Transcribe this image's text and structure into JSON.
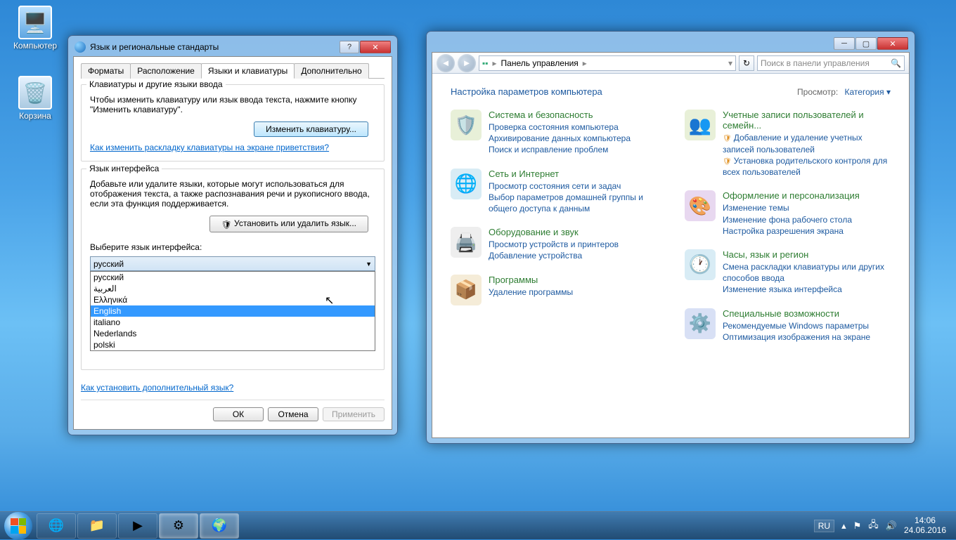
{
  "desktop": {
    "computer": "Компьютер",
    "recycle": "Корзина"
  },
  "regionDialog": {
    "title": "Язык и региональные стандарты",
    "tabs": {
      "formats": "Форматы",
      "location": "Расположение",
      "keyboards": "Языки и клавиатуры",
      "advanced": "Дополнительно"
    },
    "grp1": {
      "legend": "Клавиатуры и другие языки ввода",
      "text": "Чтобы изменить клавиатуру или язык ввода текста, нажмите кнопку \"Изменить клавиатуру\".",
      "btn": "Изменить клавиатуру...",
      "link": "Как изменить раскладку клавиатуры на экране приветствия?"
    },
    "grp2": {
      "legend": "Язык интерфейса",
      "text": "Добавьте или удалите языки, которые могут использоваться для отображения текста, а также распознавания речи и рукописного ввода, если эта функция поддерживается.",
      "btn": "Установить или удалить язык...",
      "chooseLabel": "Выберите язык интерфейса:",
      "selected": "русский",
      "options": [
        "русский",
        "العربية",
        "Ελληνικά",
        "English",
        "italiano",
        "Nederlands",
        "polski"
      ],
      "highlightedIndex": 3
    },
    "bottomLink": "Как установить дополнительный язык?",
    "buttons": {
      "ok": "ОК",
      "cancel": "Отмена",
      "apply": "Применить"
    }
  },
  "controlPanel": {
    "breadcrumb": "Панель управления",
    "searchPlaceholder": "Поиск в панели управления",
    "heading": "Настройка параметров компьютера",
    "viewLabel": "Просмотр:",
    "viewValue": "Категория",
    "left": [
      {
        "title": "Система и безопасность",
        "icon": "🛡️",
        "bg": "#e8f0d8",
        "links": [
          "Проверка состояния компьютера",
          "Архивирование данных компьютера",
          "Поиск и исправление проблем"
        ]
      },
      {
        "title": "Сеть и Интернет",
        "icon": "🌐",
        "bg": "#d8ecf5",
        "links": [
          "Просмотр состояния сети и задач",
          "Выбор параметров домашней группы и общего доступа к данным"
        ]
      },
      {
        "title": "Оборудование и звук",
        "icon": "🖨️",
        "bg": "#eee",
        "links": [
          "Просмотр устройств и принтеров",
          "Добавление устройства"
        ]
      },
      {
        "title": "Программы",
        "icon": "📦",
        "bg": "#f5ecd8",
        "links": [
          "Удаление программы"
        ]
      }
    ],
    "right": [
      {
        "title": "Учетные записи пользователей и семейн...",
        "icon": "👥",
        "bg": "#e8f0d8",
        "links": [
          "Добавление и удаление учетных записей пользователей",
          "Установка родительского контроля для всех пользователей"
        ],
        "shields": [
          true,
          true
        ]
      },
      {
        "title": "Оформление и персонализация",
        "icon": "🎨",
        "bg": "#e8d8f0",
        "links": [
          "Изменение темы",
          "Изменение фона рабочего стола",
          "Настройка разрешения экрана"
        ]
      },
      {
        "title": "Часы, язык и регион",
        "icon": "🕐",
        "bg": "#d8ecf5",
        "links": [
          "Смена раскладки клавиатуры или других способов ввода",
          "Изменение языка интерфейса"
        ]
      },
      {
        "title": "Специальные возможности",
        "icon": "⚙️",
        "bg": "#d8e0f5",
        "links": [
          "Рекомендуемые Windows параметры",
          "Оптимизация изображения на экране"
        ]
      }
    ]
  },
  "taskbar": {
    "lang": "RU",
    "time": "14:06",
    "date": "24.06.2016"
  }
}
